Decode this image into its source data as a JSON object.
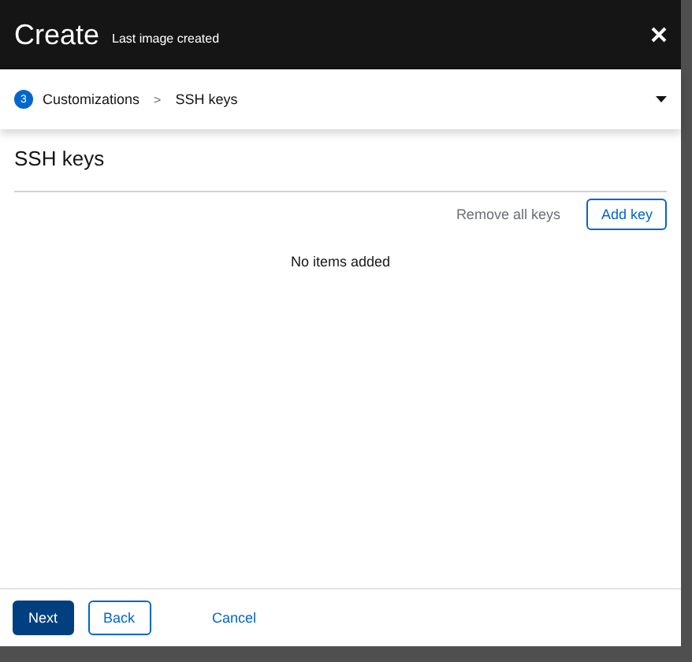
{
  "window": {
    "title": "Create",
    "tooltip": "Last image created"
  },
  "nav": {
    "step": "3",
    "section": "Customizations",
    "separator": ">",
    "current": "SSH keys"
  },
  "panel": {
    "title": "SSH keys",
    "actions": [
      {
        "label": "Remove all keys",
        "kind": "link"
      },
      {
        "label": "Add key",
        "kind": "secondary"
      }
    ],
    "empty_text": "No items added"
  },
  "footer": {
    "buttons": [
      {
        "label": "Next",
        "kind": "primary"
      },
      {
        "label": "Back",
        "kind": "secondary"
      },
      {
        "label": "Cancel",
        "kind": "link"
      }
    ]
  }
}
